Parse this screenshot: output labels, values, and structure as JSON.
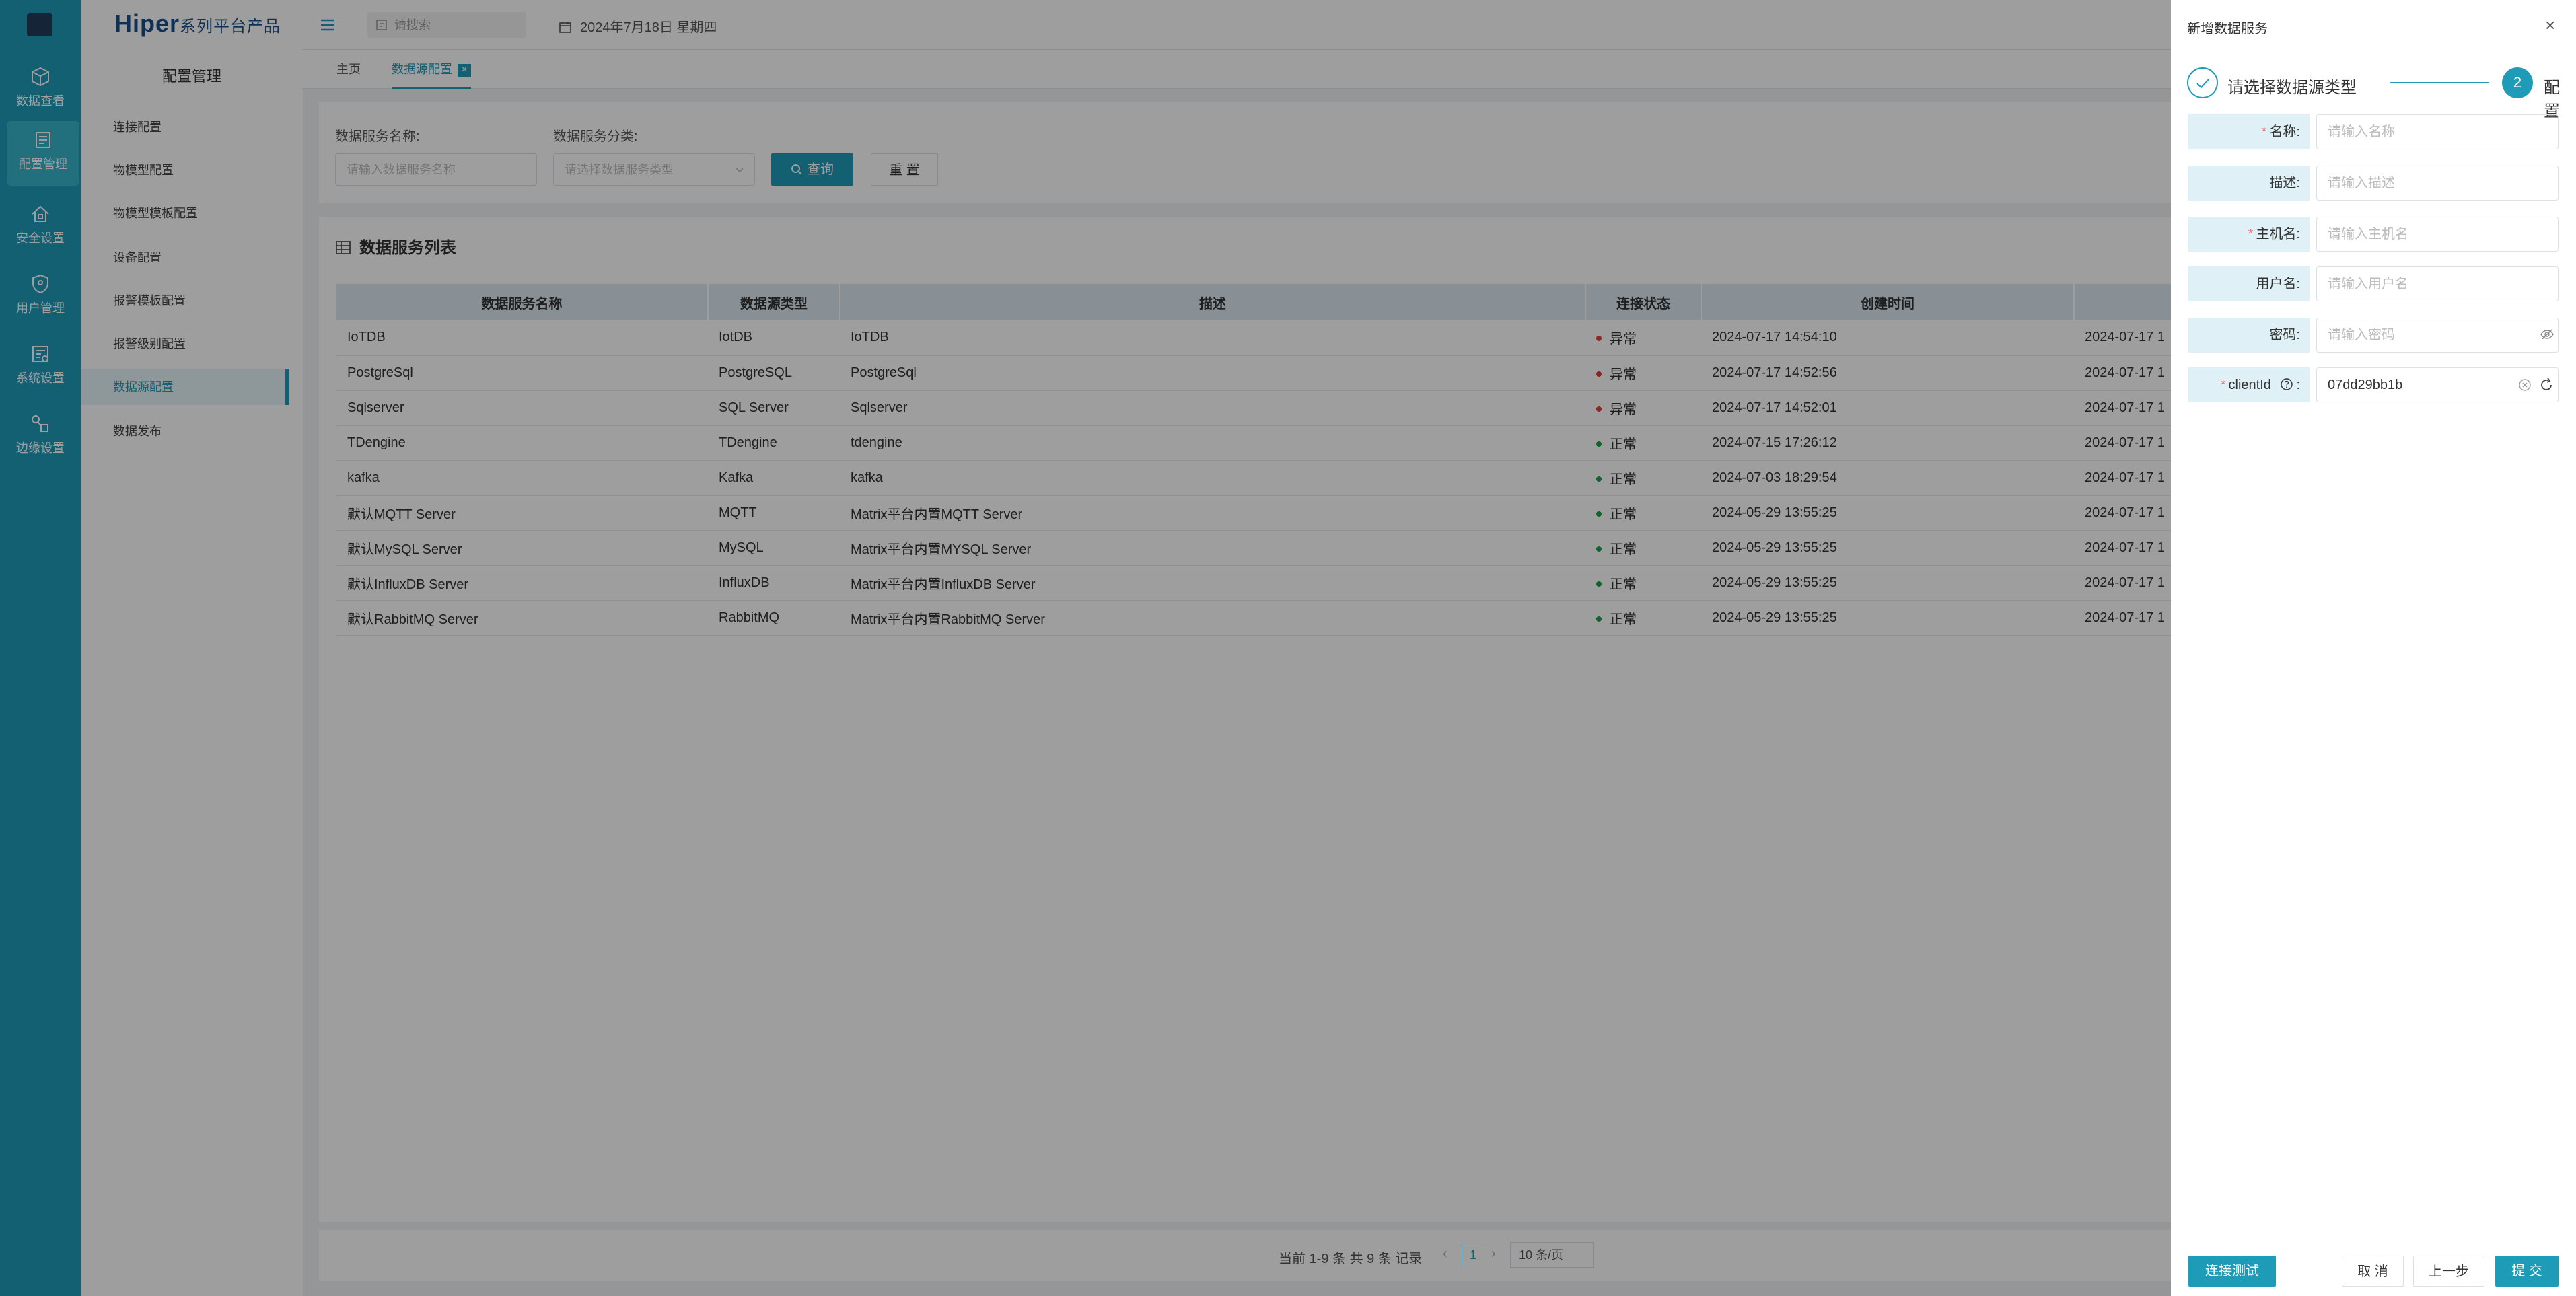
{
  "brand": {
    "main": "Hiper",
    "sub": "系列平台产品"
  },
  "iconbar": [
    {
      "label": "数据查看",
      "icon": "cube-icon"
    },
    {
      "label": "配置管理",
      "icon": "config-icon",
      "active": true
    },
    {
      "label": "安全设置",
      "icon": "home-lock-icon"
    },
    {
      "label": "用户管理",
      "icon": "shield-user-icon"
    },
    {
      "label": "系统设置",
      "icon": "system-settings-icon"
    },
    {
      "label": "边缘设置",
      "icon": "edge-icon"
    }
  ],
  "submenu": {
    "title": "配置管理",
    "items": [
      "连接配置",
      "物模型配置",
      "物模型模板配置",
      "设备配置",
      "报警模板配置",
      "报警级别配置",
      "数据源配置",
      "数据发布"
    ],
    "active_index": 6
  },
  "topbar": {
    "search_placeholder": "请搜索",
    "date": "2024年7月18日 星期四"
  },
  "tabs": [
    {
      "label": "主页"
    },
    {
      "label": "数据源配置",
      "active": true
    }
  ],
  "filter": {
    "name_label": "数据服务名称:",
    "name_placeholder": "请输入数据服务名称",
    "type_label": "数据服务分类:",
    "type_placeholder": "请选择数据服务类型",
    "query_label": "查询",
    "reset_label": "重 置"
  },
  "table": {
    "title": "数据服务列表",
    "columns": [
      "数据服务名称",
      "数据源类型",
      "描述",
      "连接状态",
      "创建时间",
      ""
    ],
    "rows": [
      {
        "name": "IoTDB",
        "type": "IotDB",
        "desc": "IoTDB",
        "status": "异常",
        "created": "2024-07-17 14:54:10",
        "updated": "2024-07-17 1"
      },
      {
        "name": "PostgreSql",
        "type": "PostgreSQL",
        "desc": "PostgreSql",
        "status": "异常",
        "created": "2024-07-17 14:52:56",
        "updated": "2024-07-17 1"
      },
      {
        "name": "Sqlserver",
        "type": "SQL Server",
        "desc": "Sqlserver",
        "status": "异常",
        "created": "2024-07-17 14:52:01",
        "updated": "2024-07-17 1"
      },
      {
        "name": "TDengine",
        "type": "TDengine",
        "desc": "tdengine",
        "status": "正常",
        "created": "2024-07-15 17:26:12",
        "updated": "2024-07-17 1"
      },
      {
        "name": "kafka",
        "type": "Kafka",
        "desc": "kafka",
        "status": "正常",
        "created": "2024-07-03 18:29:54",
        "updated": "2024-07-17 1"
      },
      {
        "name": "默认MQTT Server",
        "type": "MQTT",
        "desc": "Matrix平台内置MQTT Server",
        "status": "正常",
        "created": "2024-05-29 13:55:25",
        "updated": "2024-07-17 1"
      },
      {
        "name": "默认MySQL Server",
        "type": "MySQL",
        "desc": "Matrix平台内置MYSQL Server",
        "status": "正常",
        "created": "2024-05-29 13:55:25",
        "updated": "2024-07-17 1"
      },
      {
        "name": "默认InfluxDB Server",
        "type": "InfluxDB",
        "desc": "Matrix平台内置InfluxDB Server",
        "status": "正常",
        "created": "2024-05-29 13:55:25",
        "updated": "2024-07-17 1"
      },
      {
        "name": "默认RabbitMQ Server",
        "type": "RabbitMQ",
        "desc": "Matrix平台内置RabbitMQ Server",
        "status": "正常",
        "created": "2024-05-29 13:55:25",
        "updated": "2024-07-17 1"
      }
    ]
  },
  "pager": {
    "summary": "当前 1-9 条 共 9 条 记录",
    "prev": "‹",
    "next": "›",
    "page": "1",
    "page_size": "10 条/页"
  },
  "drawer": {
    "title": "新增数据服务",
    "close": "×",
    "step1": "请选择数据源类型",
    "step2_num": "2",
    "step2": "配置",
    "fields": [
      {
        "label": "名称:",
        "required": true,
        "placeholder": "请输入名称",
        "value": ""
      },
      {
        "label": "描述:",
        "required": false,
        "placeholder": "请输入描述",
        "value": ""
      },
      {
        "label": "主机名:",
        "required": true,
        "placeholder": "请输入主机名",
        "value": ""
      },
      {
        "label": "用户名:",
        "required": false,
        "placeholder": "请输入用户名",
        "value": ""
      },
      {
        "label": "密码:",
        "required": false,
        "placeholder": "请输入密码",
        "value": ""
      },
      {
        "label": "clientId",
        "required": true,
        "placeholder": "",
        "value": "07dd29bb1b"
      }
    ],
    "required_mark": "*",
    "clientid_colon": ":",
    "buttons": {
      "test": "连接测试",
      "cancel": "取 消",
      "prev": "上一步",
      "submit": "提 交"
    }
  },
  "colors": {
    "primary": "#1e9bb7",
    "error": "#f56c6c",
    "ok": "#16a34a",
    "error_dot": "#e53935"
  }
}
